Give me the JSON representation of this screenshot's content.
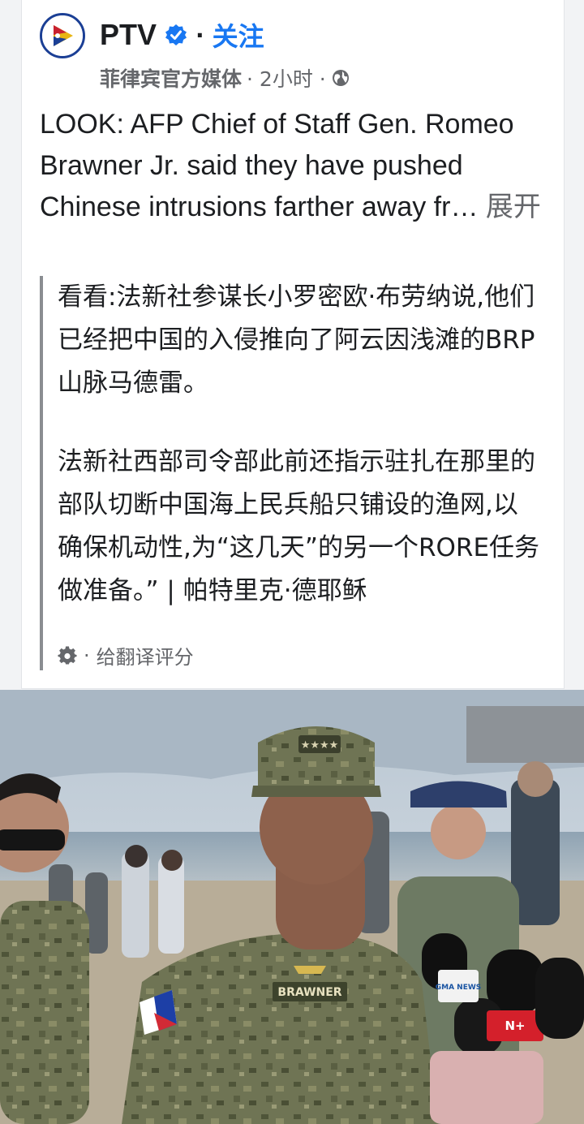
{
  "post": {
    "page_name": "PTV",
    "separator": "·",
    "follow_label": "关注",
    "category": "菲律宾官方媒体",
    "time": "· 2小时 ·",
    "text": "LOOK: AFP Chief of Staff Gen. Romeo Brawner Jr. said they have pushed Chinese intrusions farther away fr…",
    "see_more_label": "展开"
  },
  "translation": {
    "paragraph1": "看看:法新社参谋长小罗密欧·布劳纳说,他们已经把中国的入侵推向了阿云因浅滩的BRP山脉马德雷。",
    "paragraph2": "法新社西部司令部此前还指示驻扎在那里的部队切断中国海上民兵船只铺设的渔网,以确保机动性,为“这几天”的另一个RORE任务做准备。” | 帕特里克·德耶稣",
    "rate_label": "给翻译评分"
  },
  "photo": {
    "cap_insignia": "★★★★",
    "name_tape": "BRAWNER",
    "mic_labels": [
      "GMA NEWS",
      "N+"
    ]
  },
  "icons": {
    "verified": "verified-badge-icon",
    "globe": "globe-icon",
    "gear": "gear-icon"
  },
  "colors": {
    "accent": "#1877f2",
    "secondary_text": "#65676b",
    "quote_bar": "#8a8d91"
  }
}
